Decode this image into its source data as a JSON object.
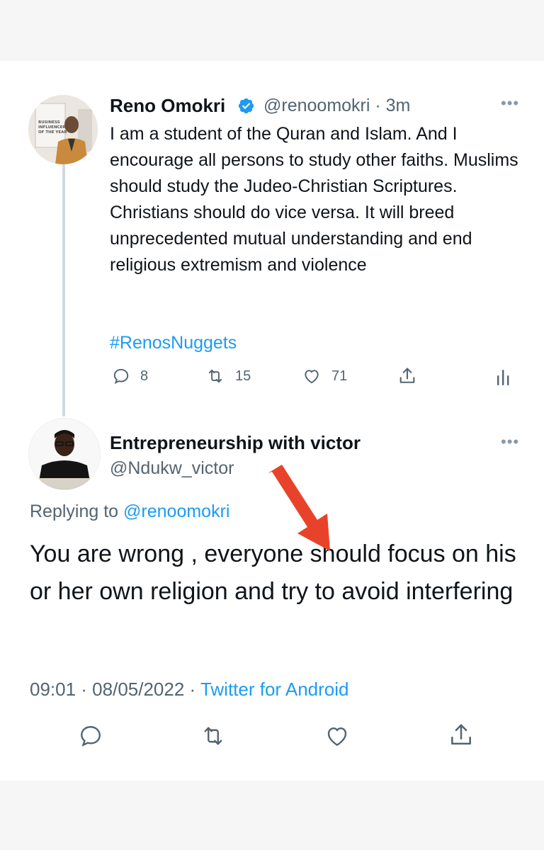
{
  "original_tweet": {
    "author_name": "Reno Omokri",
    "handle_time": "@renoomokri · 3m",
    "text": "I am a student of the Quran and Islam. And I encourage all persons to study other faiths. Muslims should study the Judeo-Christian Scriptures. Christians should do vice versa. It will breed unprecedented mutual understanding and end religious extremism and violence",
    "hashtag": "#RenosNuggets",
    "stats": {
      "replies": "8",
      "retweets": "15",
      "likes": "71"
    },
    "avatar_text": [
      "BUSINESS",
      "INFLUENCER",
      "OF THE YEAR"
    ]
  },
  "reply_tweet": {
    "author_name": "Entrepreneurship with victor",
    "handle": "@Ndukw_victor",
    "replying_prefix": "Replying to ",
    "replying_to": "@renoomokri",
    "text": "You are wrong , everyone should focus on his or her own religion and try to avoid interfering",
    "timestamp": "09:01 · 08/05/2022 · ",
    "source": "Twitter for Android"
  },
  "icons": [
    "verified-badge-icon",
    "reply-icon",
    "retweet-icon",
    "like-icon",
    "share-icon",
    "analytics-icon",
    "more-icon",
    "red-arrow"
  ],
  "colors": {
    "accent": "#1d9bf0",
    "text": "#0f1419",
    "muted": "#536471",
    "arrow": "#e8432a"
  }
}
